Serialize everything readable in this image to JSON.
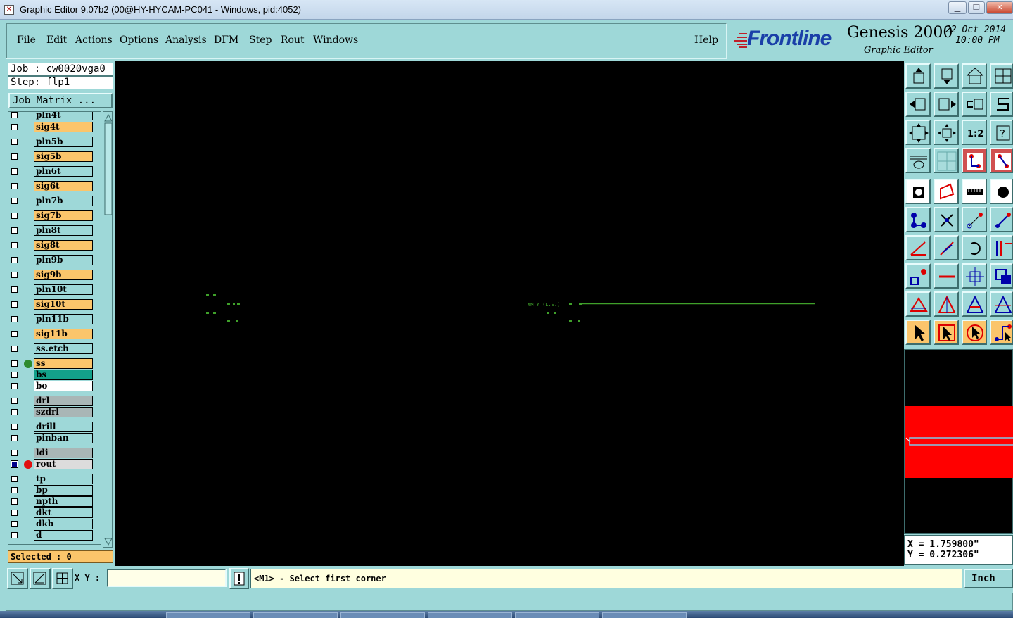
{
  "window": {
    "title": "Graphic Editor 9.07b2 (00@HY-HYCAM-PC041 - Windows, pid:4052)",
    "controls": [
      "minimize",
      "restore",
      "close"
    ]
  },
  "menu": {
    "items": [
      "File",
      "Edit",
      "Actions",
      "Options",
      "Analysis",
      "DFM",
      "Step",
      "Rout",
      "Windows"
    ],
    "help": "Help"
  },
  "logo": {
    "brand": "Frontline",
    "product": "Genesis 2000",
    "subtitle": "Graphic Editor",
    "date": "22 Oct 2014",
    "time": "10:00 PM"
  },
  "job": {
    "job_line": "Job : cw0020vga0",
    "step_line": "Step: flp1",
    "matrix_button": "Job Matrix ..."
  },
  "layers": [
    {
      "name": "pln4t",
      "color": "#9ed8d8"
    },
    {
      "name": "sig4t",
      "color": "#fbc56b"
    },
    {
      "name": "pln5b",
      "color": "#9ed8d8"
    },
    {
      "name": "sig5b",
      "color": "#fbc56b"
    },
    {
      "name": "pln6t",
      "color": "#9ed8d8"
    },
    {
      "name": "sig6t",
      "color": "#fbc56b"
    },
    {
      "name": "pln7b",
      "color": "#9ed8d8"
    },
    {
      "name": "sig7b",
      "color": "#fbc56b"
    },
    {
      "name": "pln8t",
      "color": "#9ed8d8"
    },
    {
      "name": "sig8t",
      "color": "#fbc56b"
    },
    {
      "name": "pln9b",
      "color": "#9ed8d8"
    },
    {
      "name": "sig9b",
      "color": "#fbc56b"
    },
    {
      "name": "pln10t",
      "color": "#9ed8d8"
    },
    {
      "name": "sig10t",
      "color": "#fbc56b"
    },
    {
      "name": "pln11b",
      "color": "#9ed8d8"
    },
    {
      "name": "sig11b",
      "color": "#fbc56b"
    },
    {
      "name": "ss.etch",
      "color": "#9ed8d8"
    },
    {
      "name": "ss",
      "color": "#fbc56b",
      "dot": "#2e8b2e"
    },
    {
      "name": "bs",
      "color": "#13a08a"
    },
    {
      "name": "bo",
      "color": "#ffffff"
    },
    {
      "name": "drl",
      "color": "#a9b6b6"
    },
    {
      "name": "szdrl",
      "color": "#a9b6b6"
    },
    {
      "name": "drill",
      "color": "#9ed8d8"
    },
    {
      "name": "pinban",
      "color": "#9ed8d8"
    },
    {
      "name": "ldi",
      "color": "#a9b6b6"
    },
    {
      "name": "rout",
      "color": "#dcdcdc",
      "dot": "#e01010",
      "active": true
    },
    {
      "name": "tp",
      "color": "#9ed8d8"
    },
    {
      "name": "bp",
      "color": "#9ed8d8"
    },
    {
      "name": "npth",
      "color": "#9ed8d8"
    },
    {
      "name": "dkt",
      "color": "#9ed8d8"
    },
    {
      "name": "dkb",
      "color": "#9ed8d8"
    },
    {
      "name": "d",
      "color": "#9ed8d8"
    }
  ],
  "selected": "Selected : 0",
  "canvas": {
    "background": "#000000",
    "feature_color": "#3fa02a",
    "label_text": "#M.Y (L.S.)"
  },
  "toolbar": {
    "icons": [
      "upload-icon",
      "download-icon",
      "home-icon",
      "window-icon",
      "move-left-icon",
      "move-right-icon",
      "swap-icon",
      "s-curve-icon",
      "zoom-fit-icon",
      "zoom-center-icon",
      "zoom-1-2-icon",
      "help-icon",
      "sketch-icon",
      "grid-icon",
      "net-red-icon",
      "net-red-alt-icon",
      "snap-icon",
      "polygon-icon",
      "ruler-icon",
      "pad-icon",
      "route-nodes-icon",
      "cross-icon",
      "line-point-icon",
      "line-point-red-icon",
      "angle-icon",
      "slash-icon",
      "arc-icon",
      "align-icon",
      "node-icon",
      "dash-icon",
      "resize-icon",
      "component-icon",
      "triangle-a-icon",
      "triangle-b-icon",
      "triangle-c-icon",
      "triangle-d-icon",
      "pointer-icon",
      "select-icon",
      "select-alt-icon",
      "select-route-icon"
    ],
    "zoom_label": "1:2"
  },
  "coords": {
    "x": "X = 1.759800\"",
    "y": "Y = 0.272306\""
  },
  "bottom": {
    "xy_label": "X Y :",
    "xy_value": "",
    "prompt": "<M1> - Select first corner",
    "units": "Inch"
  }
}
